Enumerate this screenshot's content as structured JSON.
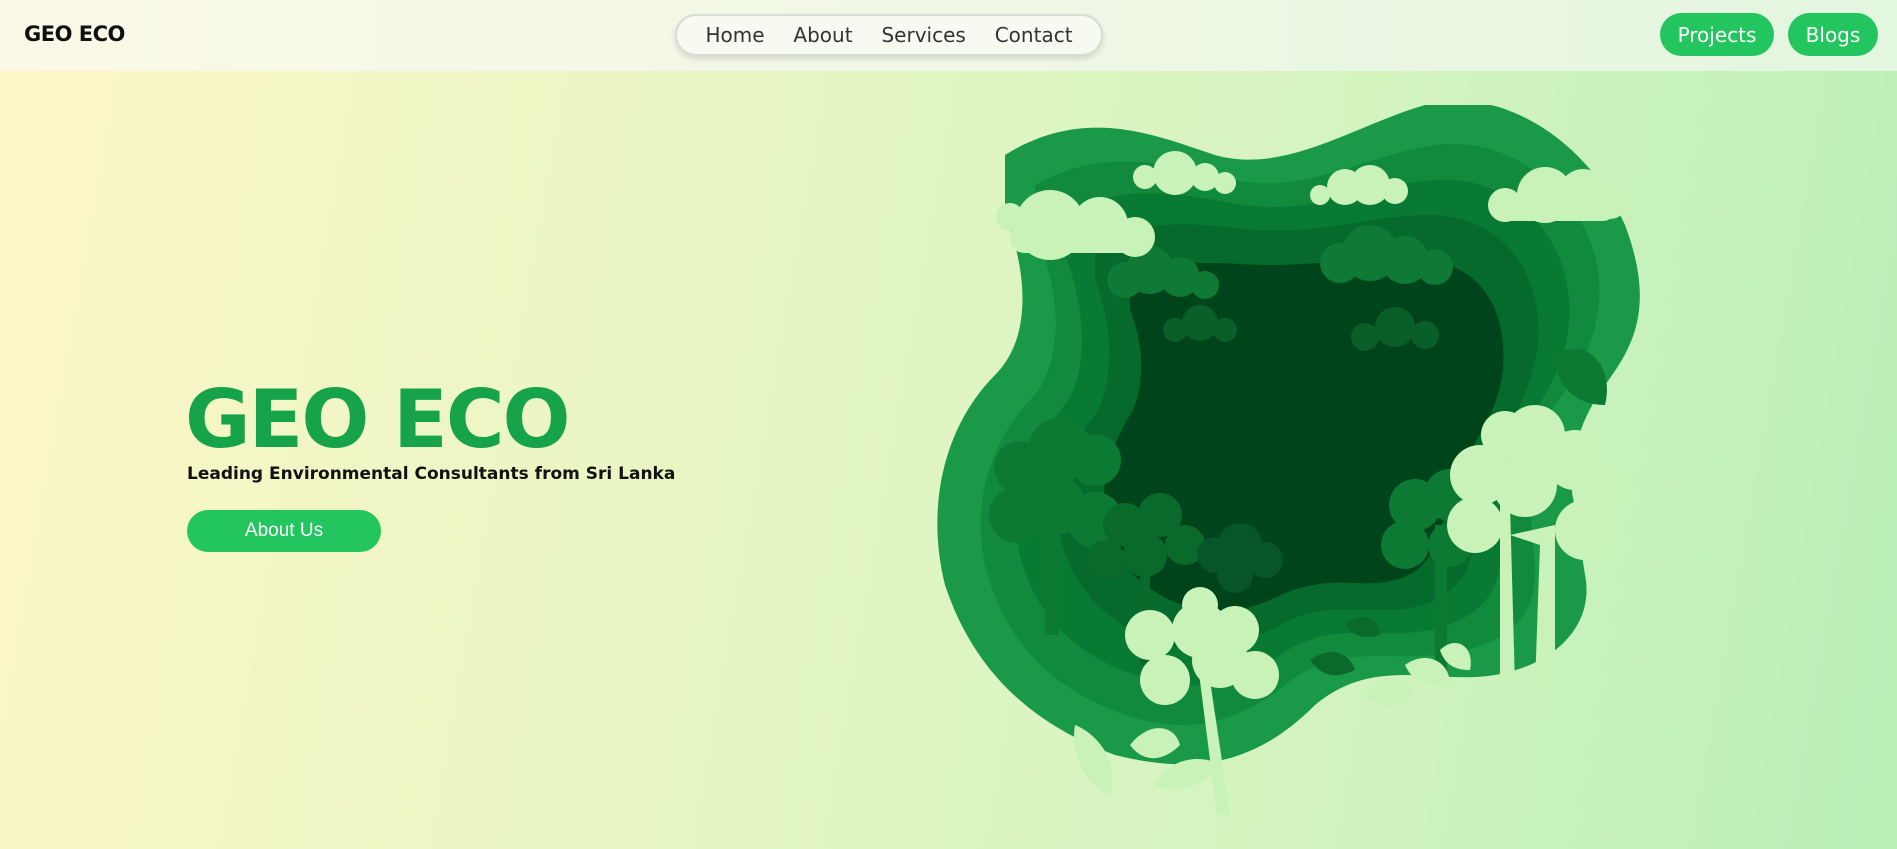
{
  "header": {
    "brand": "GEO ECO",
    "nav": [
      "Home",
      "About",
      "Services",
      "Contact"
    ],
    "projects_label": "Projects",
    "blogs_label": "Blogs"
  },
  "hero": {
    "title": "GEO ECO",
    "subtitle": "Leading Environmental Consultants from Sri Lanka",
    "cta_label": "About Us",
    "illustration": "paper-cut-forest-illustration"
  },
  "colors": {
    "accent": "#22c55e",
    "title": "#16a34a",
    "forest_dark": "#00441b",
    "forest_mid": "#0f8a3e",
    "forest_light": "#c8f2b8"
  }
}
